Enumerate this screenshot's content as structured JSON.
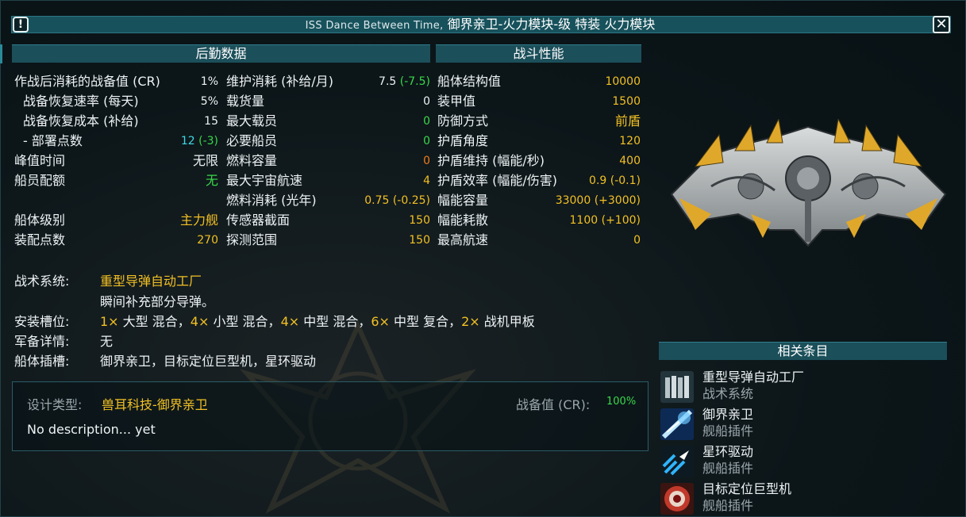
{
  "window": {
    "title_en": "ISS Dance Between Time,",
    "title_cn": "御界亲卫-火力模块-级 特装 火力模块",
    "warn_symbol": "!",
    "close_symbol": "✕"
  },
  "logistics": {
    "header": "后勤数据",
    "col1": [
      {
        "label": "作战后消耗的战备值 (CR)",
        "value": "1%"
      },
      {
        "label": "战备恢复速率 (每天)",
        "value": "5%"
      },
      {
        "label": "战备恢复成本 (补给)",
        "value": "15"
      },
      {
        "label": "- 部署点数",
        "value": "12",
        "value_extra": "(-3)"
      },
      {
        "label": "峰值时间",
        "value": "无限"
      },
      {
        "label": "船员配额",
        "value": "无"
      },
      {
        "label": "船体级别",
        "value": "主力舰"
      },
      {
        "label": "装配点数",
        "value": "270"
      }
    ],
    "col2": [
      {
        "label": "维护消耗 (补给/月)",
        "value": "7.5",
        "value_extra": "(-7.5)"
      },
      {
        "label": "载货量",
        "value": "0"
      },
      {
        "label": "最大载员",
        "value": "0"
      },
      {
        "label": "必要船员",
        "value": "0"
      },
      {
        "label": "燃料容量",
        "value": "0"
      },
      {
        "label": "最大宇宙航速",
        "value": "4"
      },
      {
        "label": "燃料消耗 (光年)",
        "value": "0.75",
        "value_extra": "(-0.25)"
      },
      {
        "label": "传感器截面",
        "value": "150"
      },
      {
        "label": "探测范围",
        "value": "150"
      }
    ]
  },
  "combat": {
    "header": "战斗性能",
    "rows": [
      {
        "label": "船体结构值",
        "value": "10000"
      },
      {
        "label": "装甲值",
        "value": "1500"
      },
      {
        "label": "防御方式",
        "value": "前盾"
      },
      {
        "label": "护盾角度",
        "value": "120"
      },
      {
        "label": "护盾维持 (幅能/秒)",
        "value": "400"
      },
      {
        "label": "护盾效率 (幅能/伤害)",
        "value": "0.9",
        "value_extra": "(-0.1)"
      },
      {
        "label": "幅能容量",
        "value": "33000",
        "value_extra": "(+3000)"
      },
      {
        "label": "幅能耗散",
        "value": "1100",
        "value_extra": "(+100)"
      },
      {
        "label": "最高航速",
        "value": "0"
      }
    ]
  },
  "systems": {
    "tactical_label": "战术系统:",
    "tactical_value": "重型导弹自动工厂",
    "tactical_desc": "瞬间补充部分导弹。",
    "slots_label": "安装槽位:",
    "slots": [
      {
        "count": "1×",
        "text": " 大型 混合，"
      },
      {
        "count": "4×",
        "text": " 小型 混合，"
      },
      {
        "count": "4×",
        "text": " 中型 混合，"
      },
      {
        "count": "6×",
        "text": " 中型 复合，"
      },
      {
        "count": "2×",
        "text": " 战机甲板"
      }
    ],
    "armament_label": "军备详情:",
    "armament_value": "无",
    "hullmods_label": "船体插槽:",
    "hullmods_value": "御界亲卫，目标定位巨型机，星环驱动"
  },
  "design": {
    "type_label": "设计类型:",
    "type_value": "兽耳科技-御界亲卫",
    "cr_label": "战备值 (CR):",
    "cr_value": "100%",
    "description": "No description... yet"
  },
  "related": {
    "header": "相关条目",
    "items": [
      {
        "title": "重型导弹自动工厂",
        "subtitle": "战术系统",
        "icon": "missile-rack-icon"
      },
      {
        "title": "御界亲卫",
        "subtitle": "舰船插件",
        "icon": "shield-burst-icon"
      },
      {
        "title": "星环驱动",
        "subtitle": "舰船插件",
        "icon": "thruster-arrows-icon"
      },
      {
        "title": "目标定位巨型机",
        "subtitle": "舰船插件",
        "icon": "targeting-eye-icon"
      }
    ]
  },
  "colors": {
    "accent_yellow": "#f2c024",
    "accent_green": "#39d84a",
    "accent_cyan": "#3fd8e6",
    "accent_orange": "#f07a1a",
    "header_bg": "#1b4f5a"
  }
}
